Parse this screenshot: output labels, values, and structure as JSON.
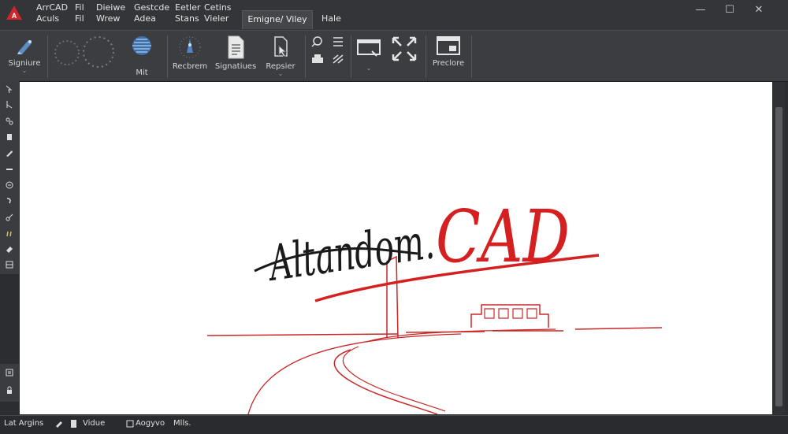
{
  "app": {
    "logo_icon": "autocad-logo-icon"
  },
  "menu": {
    "columns": [
      {
        "top": "ArrCAD",
        "bottom": "Aculs"
      },
      {
        "top": "Fil",
        "bottom": "Fil"
      },
      {
        "top": "Dieiwe",
        "bottom": "Wrew"
      },
      {
        "top": "Gestcde",
        "bottom": "Adea"
      },
      {
        "top": "Eetler",
        "bottom": "Stans"
      },
      {
        "top": "Cetins",
        "bottom": "Vieler"
      }
    ],
    "active_tab": "Emigne/ Viley",
    "help": "Hale"
  },
  "window_controls": {
    "minimize": "—",
    "maximize": "☐",
    "close": "✕"
  },
  "ribbon": {
    "signature_label": "Signiure",
    "mit_label": "Mit",
    "recbrem_label": "Recbrem",
    "signatures_label": "Signatiues",
    "repsier_label": "Repsier",
    "preclore_label": "Preclore"
  },
  "left_toolbar": {
    "icons": [
      "pointer-icon",
      "select-icon",
      "node-icon",
      "layer-icon",
      "brush-icon",
      "line-icon",
      "pen-icon",
      "curve-icon",
      "scissors-icon",
      "pencil-icon",
      "eraser-icon",
      "grid-icon"
    ],
    "bottom_icons": [
      "layers-icon",
      "lock-icon"
    ]
  },
  "drawing": {
    "signature_text": "Altandom.",
    "cad_text": "CAD",
    "ink_color": "#1a1a1a",
    "accent_color": "#d42020"
  },
  "statusbar": {
    "item1": "Lat Argins",
    "item2": "Vidue",
    "item3": "Aogyvo",
    "item4": "Mlls."
  },
  "colors": {
    "ribbon_bg": "#3b3d40",
    "titlebar_bg": "#333538",
    "canvas_bg": "#ffffff",
    "accent_red": "#d42020"
  }
}
